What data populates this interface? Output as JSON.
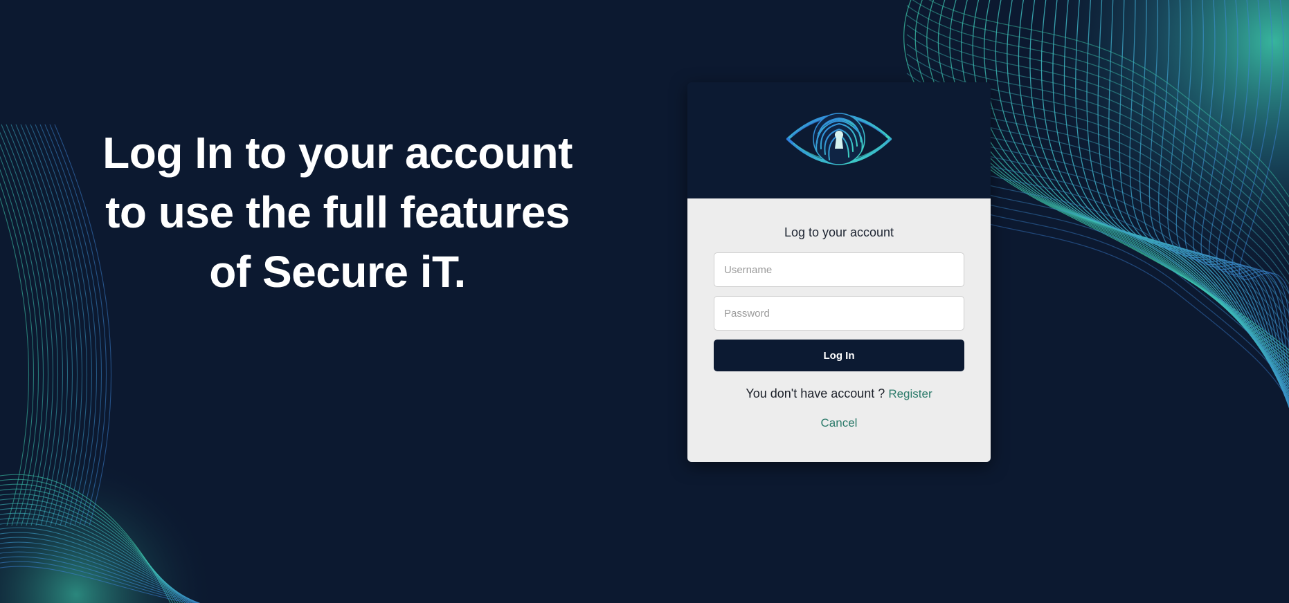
{
  "hero": {
    "lines": [
      "Log In to your account",
      "to use the full features",
      "of Secure iT."
    ]
  },
  "logo": {
    "icon": "eye-fingerprint-keyhole-icon"
  },
  "login_form": {
    "title": "Log to your account",
    "username_placeholder": "Username",
    "password_placeholder": "Password",
    "submit_label": "Log In",
    "register_prompt": "You don't have account ?",
    "register_link": "Register",
    "cancel_link": "Cancel"
  },
  "colors": {
    "background": "#0c1930",
    "card_header": "#0c1a32",
    "card_body": "#ededed",
    "button": "#0c1a32",
    "link": "#2b7a6a",
    "wave_teal": "#3fd0b0",
    "wave_blue": "#3a7fd0"
  }
}
